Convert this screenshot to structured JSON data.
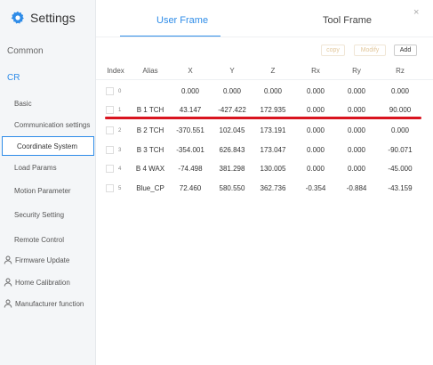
{
  "sidebar": {
    "title": "Settings",
    "sections": {
      "common": "Common",
      "cr": "CR"
    },
    "items": [
      {
        "label": "Basic"
      },
      {
        "label": "Communication settings"
      },
      {
        "label": "Coordinate System"
      },
      {
        "label": "Load Params"
      },
      {
        "label": "Motion Parameter"
      },
      {
        "label": "Security Setting"
      },
      {
        "label": "Remote Control"
      }
    ],
    "links": [
      {
        "label": "Firmware Update"
      },
      {
        "label": "Home Calibration"
      },
      {
        "label": "Manufacturer function"
      }
    ]
  },
  "main": {
    "tabs": {
      "user": "User Frame",
      "tool": "Tool Frame"
    },
    "close_icon": "×",
    "buttons": {
      "copy": "copy",
      "modify": "Modify",
      "add": "Add"
    },
    "table": {
      "headers": [
        "Index",
        "Alias",
        "X",
        "Y",
        "Z",
        "Rx",
        "Ry",
        "Rz"
      ],
      "rows": [
        {
          "index": "0",
          "alias": "",
          "x": "0.000",
          "y": "0.000",
          "z": "0.000",
          "rx": "0.000",
          "ry": "0.000",
          "rz": "0.000"
        },
        {
          "index": "1",
          "alias": "B 1 TCH",
          "x": "43.147",
          "y": "-427.422",
          "z": "172.935",
          "rx": "0.000",
          "ry": "0.000",
          "rz": "90.000"
        },
        {
          "index": "2",
          "alias": "B 2 TCH",
          "x": "-370.551",
          "y": "102.045",
          "z": "173.191",
          "rx": "0.000",
          "ry": "0.000",
          "rz": "0.000"
        },
        {
          "index": "3",
          "alias": "B 3 TCH",
          "x": "-354.001",
          "y": "626.843",
          "z": "173.047",
          "rx": "0.000",
          "ry": "0.000",
          "rz": "-90.071"
        },
        {
          "index": "4",
          "alias": "B 4 WAX",
          "x": "-74.498",
          "y": "381.298",
          "z": "130.005",
          "rx": "0.000",
          "ry": "0.000",
          "rz": "-45.000"
        },
        {
          "index": "5",
          "alias": "Blue_CP",
          "x": "72.460",
          "y": "580.550",
          "z": "362.736",
          "rx": "-0.354",
          "ry": "-0.884",
          "rz": "-43.159"
        }
      ]
    }
  },
  "colors": {
    "accent": "#2e8ce8",
    "annotation": "#d9141f"
  }
}
